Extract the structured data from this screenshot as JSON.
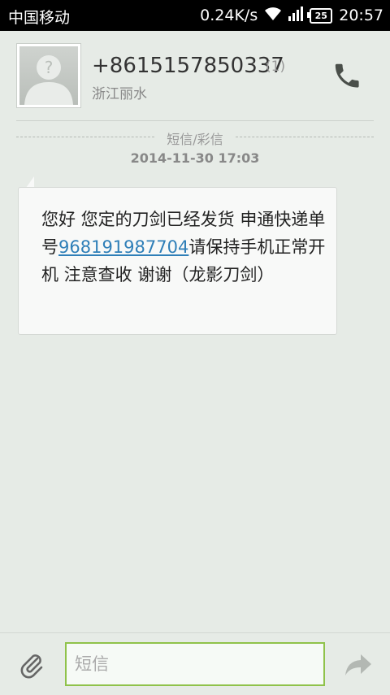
{
  "status_bar": {
    "carrier": "中国移动",
    "net_speed": "0.24K/s",
    "battery": "25",
    "time": "20:57",
    "icons": [
      "wifi-icon",
      "signal-icon",
      "battery-icon"
    ]
  },
  "contact": {
    "number": "+8615157850337",
    "count": "(1)",
    "location": "浙江丽水",
    "avatar_icon": "default-avatar-icon",
    "call_icon": "phone-icon"
  },
  "thread": {
    "separator_label": "短信/彩信",
    "timestamp": "2014-11-30 17:03",
    "message": {
      "text_before": "您好 您定的刀剑已经发货 申通快递单号",
      "link": "968191987704",
      "text_after": "请保持手机正常开机 注意查收 谢谢（龙影刀剑）"
    }
  },
  "composer": {
    "placeholder": "短信",
    "value": "",
    "attach_icon": "paperclip-icon",
    "send_icon": "send-arrow-icon"
  },
  "colors": {
    "background": "#e6ebe6",
    "link": "#2f7fb8",
    "input_border": "#8fc24a",
    "call_icon": "#4a4f4a"
  }
}
